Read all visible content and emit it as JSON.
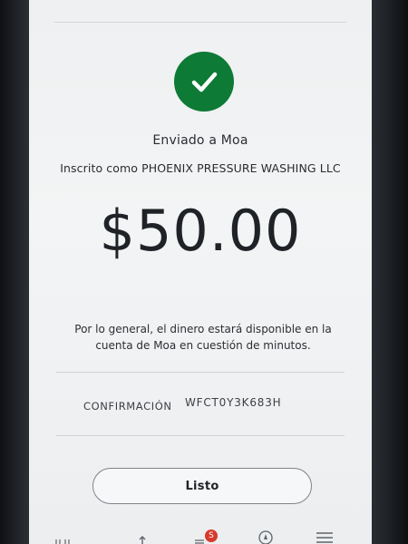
{
  "confirmation_screen": {
    "title": "Enviado a Moa",
    "subtitle": "Inscrito como PHOENIX PRESSURE WASHING LLC",
    "amount": "$50.00",
    "note": "Por lo general, el dinero estará disponible en la cuenta de Moa en cuestión de minutos.",
    "confirmation_label": "CONFIRMACIÓN",
    "confirmation_value": "WFCT0Y3K683H",
    "done_label": "Listo",
    "success_icon": "checkmark-icon",
    "accent_color": "#0d7a35"
  },
  "tab_bar": {
    "badge_text": "S",
    "badge_color": "#d73a2c",
    "icons": [
      "accounts-icon",
      "transfer-icon",
      "pay-icon",
      "explore-icon",
      "menu-icon"
    ]
  }
}
